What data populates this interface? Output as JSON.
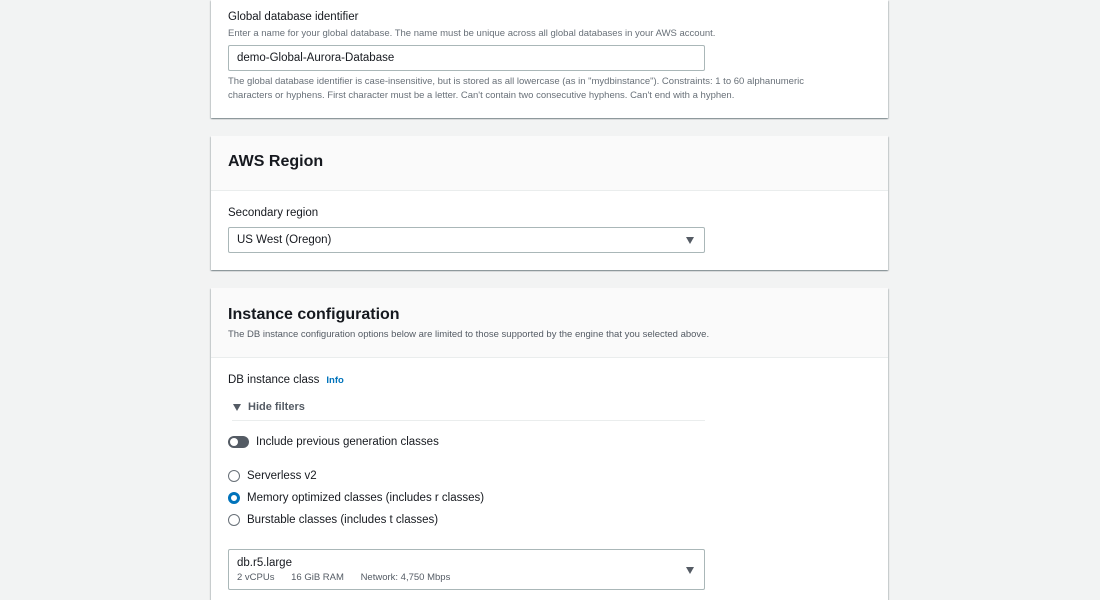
{
  "global_db": {
    "label": "Global database identifier",
    "hint": "Enter a name for your global database. The name must be unique across all global databases in your AWS account.",
    "value": "demo-Global-Aurora-Database",
    "constraint_line1": "The global database identifier is case-insensitive, but is stored as all lowercase (as in \"mydbinstance\"). Constraints: 1 to 60 alphanumeric",
    "constraint_line2": "characters or hyphens. First character must be a letter. Can't contain two consecutive hyphens. Can't end with a hyphen."
  },
  "aws_region": {
    "title": "AWS Region",
    "secondary_label": "Secondary region",
    "secondary_value": "US West (Oregon)"
  },
  "instance_config": {
    "title": "Instance configuration",
    "description": "The DB instance configuration options below are limited to those supported by the engine that you selected above.",
    "class_label": "DB instance class",
    "info_link": "Info",
    "hide_filters": "Hide filters",
    "toggle_label": "Include previous generation classes",
    "toggle_on": false,
    "radios": [
      {
        "label": "Serverless v2",
        "checked": false
      },
      {
        "label": "Memory optimized classes (includes r classes)",
        "checked": true
      },
      {
        "label": "Burstable classes (includes t classes)",
        "checked": false
      }
    ],
    "instance_select": {
      "value": "db.r5.large",
      "vcpus": "2 vCPUs",
      "ram": "16 GiB RAM",
      "network": "Network: 4,750 Mbps"
    }
  },
  "colors": {
    "accent": "#0073bb",
    "page_bg": "#f2f3f3",
    "header_bg": "#fafafa"
  },
  "icons": {
    "dropdown": "caret-down-icon",
    "expand": "triangle-down-icon"
  }
}
